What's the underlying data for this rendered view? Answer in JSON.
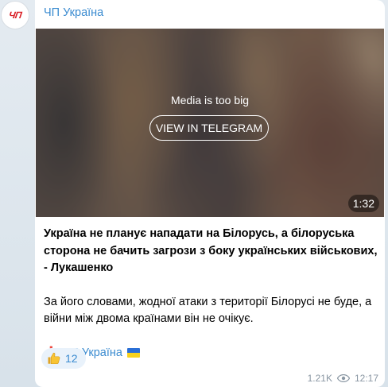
{
  "channel": {
    "name": "ЧП Україна",
    "avatar_text": "ЧП"
  },
  "media": {
    "notice": "Media is too big",
    "button_label": "VIEW IN TELEGRAM",
    "duration": "1:32"
  },
  "message": {
    "headline": "Україна не планує нападати на Білорусь, а білоруська сторона не бачить загрози з боку українських військових, - Лукашенко",
    "body": "За його словами, жодної атаки з території Білорусі не буде, а війни між двома країнами він не очікує.",
    "signature_mark": "❗",
    "signature_text": "ЧП Україна"
  },
  "reaction": {
    "icon": "thumbs-up-icon",
    "count": "12"
  },
  "meta": {
    "views": "1.21K",
    "time": "12:17"
  },
  "colors": {
    "accent": "#3a8bd0",
    "avatar_brand": "#d91f26",
    "meta_gray": "#8a97a3",
    "reaction_bg": "#e9f2fb"
  }
}
